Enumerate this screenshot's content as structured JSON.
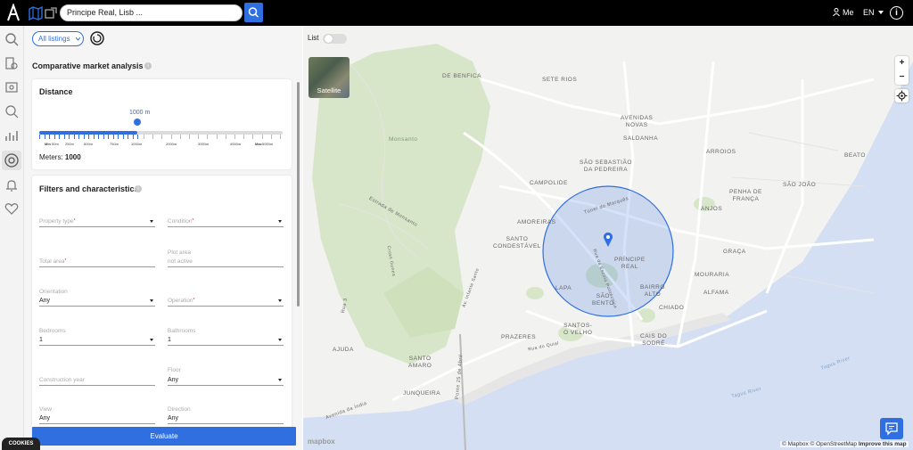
{
  "topbar": {
    "search_value": "Principe Real, Lisb ...",
    "me_label": "Me",
    "lang_label": "EN",
    "info_label": "i"
  },
  "panel": {
    "filter_label": "All listings",
    "cma_title": "Comparative market analysis",
    "distance": {
      "title": "Distance",
      "slider_value_label": "1000 m",
      "slider_value": 1000,
      "ticks": [
        "Min",
        "50m",
        "250m",
        "500m",
        "750m",
        "1000m",
        "2000m",
        "3000m",
        "4000m",
        "Max",
        "5000m"
      ],
      "meters_label": "Meters:",
      "meters_value": "1000"
    },
    "filters": {
      "title": "Filters and characteristics",
      "property_type": {
        "label": "Property type",
        "value": ""
      },
      "condition": {
        "label": "Condition",
        "value": ""
      },
      "total_area": {
        "label": "Total area",
        "value": ""
      },
      "plot_area": {
        "label": "Plot area",
        "value": "not active"
      },
      "orientation": {
        "label": "Orientation",
        "value": "Any"
      },
      "operation": {
        "label": "Operation",
        "value": ""
      },
      "bedrooms": {
        "label": "Bedrooms",
        "value": "1"
      },
      "bathrooms": {
        "label": "Bathrooms",
        "value": "1"
      },
      "construction_year": {
        "label": "Construction year",
        "value": ""
      },
      "floor": {
        "label": "Floor",
        "value": "Any"
      },
      "view": {
        "label": "View",
        "value": "Any"
      },
      "direction": {
        "label": "Direction",
        "value": "Any"
      }
    },
    "evaluate_label": "Evaluate",
    "cookies_label": "COOKIES"
  },
  "map": {
    "list_label": "List",
    "satellite_label": "Satellite",
    "zoom_in": "+",
    "zoom_out": "−",
    "attribution": "© Mapbox © OpenStreetMap",
    "improve": "Improve this map",
    "logo": "mapbox",
    "labels": {
      "benfica": "DE BENFICA",
      "sete_rios": "SETE RIOS",
      "avenidas_novas": "AVENIDAS\nNOVAS",
      "saldanha": "SALDANHA",
      "monsanto": "Monsanto",
      "sao_sebastiao": "SÃO SEBASTIÃO\nDA PEDREIRA",
      "arroios": "ARROIOS",
      "beato": "BEATO",
      "campolide": "CAMPOLIDE",
      "penha": "PENHA DE\nFRANÇA",
      "sao_joao": "SÃO JOÃO",
      "anjos": "ANJOS",
      "amoreiras": "AMOREIRAS",
      "santo_condestavel": "SANTO\nCONDESTÁVEL",
      "principe_real": "PRÍNCIPE\nREAL",
      "graca": "GRAÇA",
      "lapa": "LAPA",
      "sao_bento": "SÃO\nBENTO",
      "bairro_alto": "BAIRRO\nALTO",
      "mouraria": "MOURARIA",
      "alfama": "ALFAMA",
      "chiado": "CHIADO",
      "santos": "SANTOS-\nO VELHO",
      "prazeres": "PRAZERES",
      "ajuda": "AJUDA",
      "santo_amaro": "SANTO\nAMARO",
      "cais_sodre": "CAIS DO\nSODRÉ",
      "junqueira": "JUNQUEIRA",
      "tunel": "Túnel do Marquês",
      "estrada": "Estrada de Monsanto",
      "rua_escola": "Rua da Escola Politécnica",
      "rua3": "Rua 3",
      "ponte": "Ponte 25 de Abril",
      "av_india": "Avenida da Índia",
      "tagus1": "Tagus River",
      "tagus2": "Tagus River",
      "rua_quial": "Rua do Quial",
      "cross_gunea": "Cross Gunea",
      "av_infante": "Av. Infante Santo"
    }
  },
  "colors": {
    "accent": "#2f6fe0",
    "topbar": "#000000",
    "park": "#d7e6c8",
    "water": "#d4dff3"
  }
}
